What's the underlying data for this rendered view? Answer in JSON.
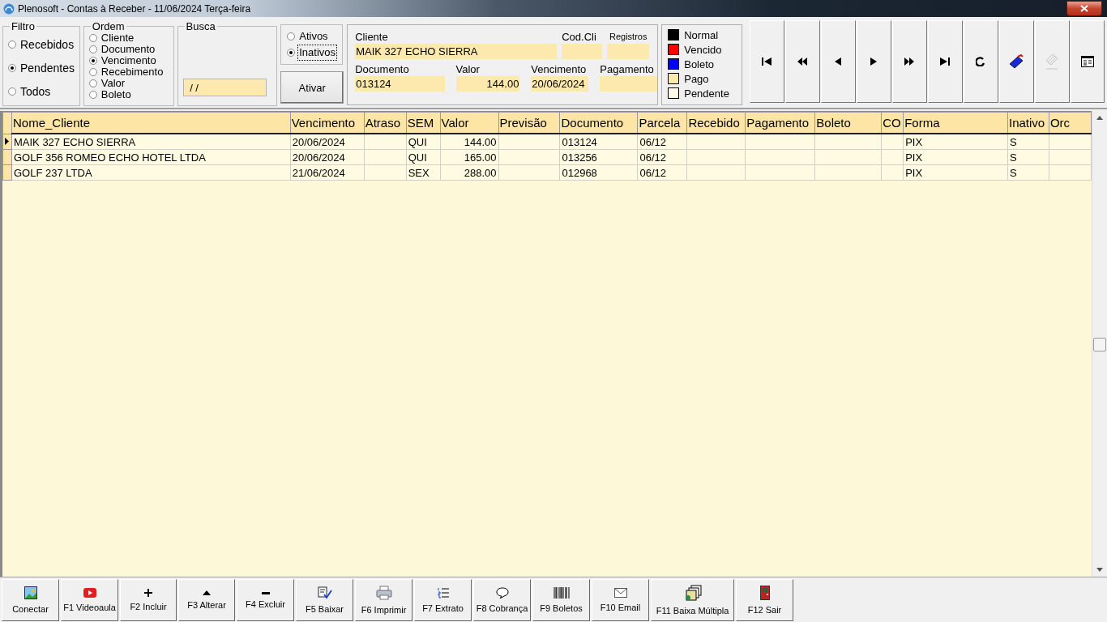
{
  "window": {
    "title": "Plenosoft - Contas à Receber - 11/06/2024 Terça-feira"
  },
  "filter": {
    "label": "Filtro",
    "options": [
      {
        "label": "Recebidos",
        "selected": false
      },
      {
        "label": "Pendentes",
        "selected": true
      },
      {
        "label": "Todos",
        "selected": false
      }
    ]
  },
  "order": {
    "label": "Ordem",
    "options": [
      {
        "label": "Cliente",
        "selected": false
      },
      {
        "label": "Documento",
        "selected": false
      },
      {
        "label": "Vencimento",
        "selected": true
      },
      {
        "label": "Recebimento",
        "selected": false
      },
      {
        "label": "Valor",
        "selected": false
      },
      {
        "label": "Boleto",
        "selected": false
      }
    ]
  },
  "search": {
    "label": "Busca",
    "value": " / /"
  },
  "status": {
    "options": [
      {
        "label": "Ativos",
        "selected": false,
        "focused": false
      },
      {
        "label": "Inativos",
        "selected": true,
        "focused": true
      }
    ]
  },
  "activate_button": "Ativar",
  "details": {
    "fields": [
      {
        "label": "Cliente",
        "value": "MAIK 327 ECHO SIERRA",
        "kind": "text"
      },
      {
        "label": "Cod.Cli",
        "kind": "text"
      },
      {
        "label": "Registros",
        "kind": "small"
      },
      {
        "label": "Documento",
        "value": "013124",
        "kind": "text"
      },
      {
        "label": "Valor",
        "value": "144.00",
        "kind": "number"
      },
      {
        "label": "Vencimento",
        "value": "20/06/2024",
        "kind": "text"
      },
      {
        "label": "Pagamento",
        "kind": "text"
      }
    ]
  },
  "legend": [
    {
      "label": "Normal",
      "color": "#000000"
    },
    {
      "label": "Vencido",
      "color": "#ff0000"
    },
    {
      "label": "Boleto",
      "color": "#0000ff"
    },
    {
      "label": "Pago",
      "color": "#fde9ad"
    },
    {
      "label": "Pendente",
      "color": "#fffbe6"
    }
  ],
  "navigator": [
    {
      "kind": "first",
      "disabled": false
    },
    {
      "kind": "prior-page",
      "disabled": false
    },
    {
      "kind": "prior",
      "disabled": false
    },
    {
      "kind": "next",
      "disabled": false
    },
    {
      "kind": "next-page",
      "disabled": false
    },
    {
      "kind": "last",
      "disabled": false
    },
    {
      "kind": "refresh",
      "disabled": false
    },
    {
      "kind": "book",
      "disabled": false
    },
    {
      "kind": "goto",
      "disabled": true
    },
    {
      "kind": "form",
      "disabled": false
    }
  ],
  "table": {
    "columns": [
      {
        "label": "Nome_Cliente",
        "kind": "text"
      },
      {
        "label": "Vencimento",
        "kind": "text"
      },
      {
        "label": "Atraso",
        "kind": "text"
      },
      {
        "label": "SEM",
        "kind": "text"
      },
      {
        "label": "Valor",
        "kind": "number"
      },
      {
        "label": "Previsão",
        "kind": "text"
      },
      {
        "label": "Documento",
        "kind": "text"
      },
      {
        "label": "Parcela",
        "kind": "text"
      },
      {
        "label": "Recebido",
        "kind": "text"
      },
      {
        "label": "Pagamento",
        "kind": "text"
      },
      {
        "label": "Boleto",
        "kind": "text"
      },
      {
        "label": "CO",
        "kind": "text"
      },
      {
        "label": "Forma",
        "kind": "text"
      },
      {
        "label": "Inativo",
        "kind": "text"
      },
      {
        "label": "Orc",
        "kind": "text"
      }
    ],
    "rows": [
      {
        "selected": true,
        "cells": [
          "MAIK 327 ECHO SIERRA",
          "20/06/2024",
          "",
          "QUI",
          "144.00",
          "",
          "013124",
          "06/12",
          "",
          "",
          "",
          "",
          "PIX",
          "S",
          ""
        ]
      },
      {
        "selected": false,
        "cells": [
          "GOLF 356 ROMEO ECHO HOTEL LTDA",
          "20/06/2024",
          "",
          "QUI",
          "165.00",
          "",
          "013256",
          "06/12",
          "",
          "",
          "",
          "",
          "PIX",
          "S",
          ""
        ]
      },
      {
        "selected": false,
        "cells": [
          "GOLF 237 LTDA",
          "21/06/2024",
          "",
          "SEX",
          "288.00",
          "",
          "012968",
          "06/12",
          "",
          "",
          "",
          "",
          "PIX",
          "S",
          ""
        ]
      }
    ]
  },
  "toolbar": [
    {
      "label": "Conectar",
      "kind": "connect"
    },
    {
      "label": "F1 Videoaula",
      "kind": "video"
    },
    {
      "label": "F2 Incluir",
      "kind": "plus"
    },
    {
      "label": "F3 Alterar",
      "kind": "up"
    },
    {
      "label": "F4 Excluir",
      "kind": "minus"
    },
    {
      "label": "F5 Baixar",
      "kind": "check-doc"
    },
    {
      "label": "F6 Imprimir",
      "kind": "printer"
    },
    {
      "label": "F7 Extrato",
      "kind": "list"
    },
    {
      "label": "F8 Cobrança",
      "kind": "bubble"
    },
    {
      "label": "F9 Boletos",
      "kind": "barcode"
    },
    {
      "label": "F10 Email",
      "kind": "mail"
    },
    {
      "label": "F11 Baixa Múltipla",
      "kind": "stack"
    },
    {
      "label": "F12 Sair",
      "kind": "door"
    }
  ]
}
